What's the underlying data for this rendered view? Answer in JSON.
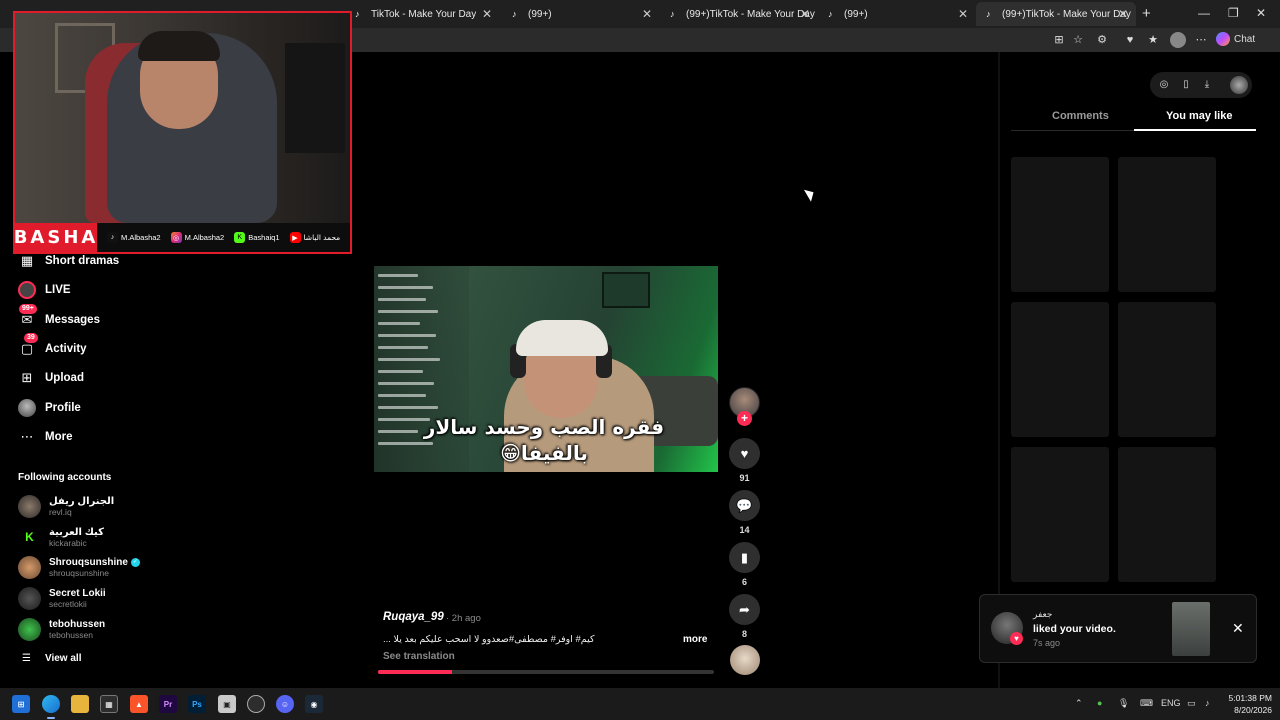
{
  "browser": {
    "tabs": [
      {
        "title": "TikTok - Make Your Day",
        "active": false
      },
      {
        "title": "(99+)",
        "active": false
      },
      {
        "title": "(99+)TikTok - Make Your Day",
        "active": false
      },
      {
        "title": "(99+)",
        "active": false
      },
      {
        "title": "(99+)TikTok - Make Your Day",
        "active": true
      }
    ],
    "chat_label": "Chat"
  },
  "webcam": {
    "brand": "BASHA",
    "socials": [
      {
        "icon": "tiktok-icon",
        "handle": "M.Albasha2"
      },
      {
        "icon": "instagram-icon",
        "handle": "M.Albasha2"
      },
      {
        "icon": "kick-icon",
        "handle": "Bashaiq1"
      },
      {
        "icon": "youtube-icon",
        "handle": "محمد الباشا"
      }
    ]
  },
  "sidebar": {
    "nav": [
      {
        "label": "Short dramas",
        "icon": "short-dramas-icon"
      },
      {
        "label": "LIVE",
        "icon": "live-icon"
      },
      {
        "label": "Messages",
        "icon": "messages-icon",
        "badge": "99+"
      },
      {
        "label": "Activity",
        "icon": "activity-icon",
        "badge": "39"
      },
      {
        "label": "Upload",
        "icon": "upload-icon"
      },
      {
        "label": "Profile",
        "icon": "profile-avatar"
      },
      {
        "label": "More",
        "icon": "more-icon"
      }
    ],
    "following_title": "Following accounts",
    "accounts": [
      {
        "name": "الجنرال ريفل",
        "handle": "revl.iq"
      },
      {
        "name": "كيك العربية",
        "handle": "kickarabic"
      },
      {
        "name": "Shrouqsunshine",
        "handle": "shrouqsunshine",
        "verified": true
      },
      {
        "name": "Secret Lokii",
        "handle": "secretlokii"
      },
      {
        "name": "tebohussen",
        "handle": "tebohussen"
      }
    ],
    "view_all": "View all"
  },
  "video": {
    "caption_line1": "فقره الصب وحسد سالار",
    "caption_line2": "بالفيفا😁",
    "progress": 0.22
  },
  "actions": {
    "likes": "91",
    "comments": "14",
    "saves": "6",
    "shares": "8"
  },
  "description": {
    "username": "Ruqaya_99",
    "time": "· 2h ago",
    "text": "كيم# اوفر# مصطفى#صعدوو لا اسحب عليكم بعد يلا ...",
    "more": "more",
    "see_translation": "See translation"
  },
  "right_panel": {
    "tabs": [
      {
        "label": "Comments",
        "active": false
      },
      {
        "label": "You may like",
        "active": true
      }
    ]
  },
  "notification": {
    "name": "جعفر",
    "message": "liked your video.",
    "time": "7s ago"
  },
  "taskbar": {
    "lang": "ENG",
    "time": "5:01:38 PM",
    "date": "8/20/2026"
  },
  "colors": {
    "accent": "#fe2c55",
    "stream_red": "#e01b2b",
    "verified": "#20d5ec"
  }
}
